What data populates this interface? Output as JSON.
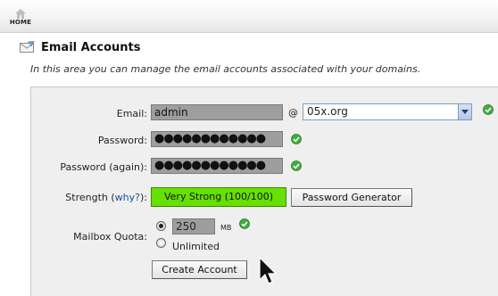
{
  "nav": {
    "home_label": "HOME"
  },
  "page": {
    "title": "Email Accounts",
    "description": "In this area you can manage the email accounts associated with your domains."
  },
  "form": {
    "email_label": "Email:",
    "email_value": "admin",
    "at_symbol": "@",
    "domain_value": "05x.org",
    "password_label": "Password:",
    "password_value": "●●●●●●●●●●●●",
    "password_again_label": "Password (again):",
    "password_again_value": "●●●●●●●●●●●●",
    "strength_label_prefix": "Strength (",
    "strength_link": "why?",
    "strength_label_suffix": "):",
    "strength_value": "Very Strong (100/100)",
    "password_generator_label": "Password Generator",
    "quota_label": "Mailbox Quota:",
    "quota_value": "250",
    "quota_unit": "MB",
    "quota_unlimited_label": "Unlimited",
    "quota_selected": "limited",
    "create_button_label": "Create Account"
  },
  "colors": {
    "strength_bar": "#66e000",
    "valid_check": "#3fae3f",
    "input_fill": "#9e9e9e",
    "link": "#1a4f9a"
  },
  "icons": {
    "home": "home-icon",
    "email": "envelope-icon",
    "valid": "check-icon",
    "cursor": "mouse-pointer-icon",
    "dropdown": "chevron-down-icon"
  }
}
